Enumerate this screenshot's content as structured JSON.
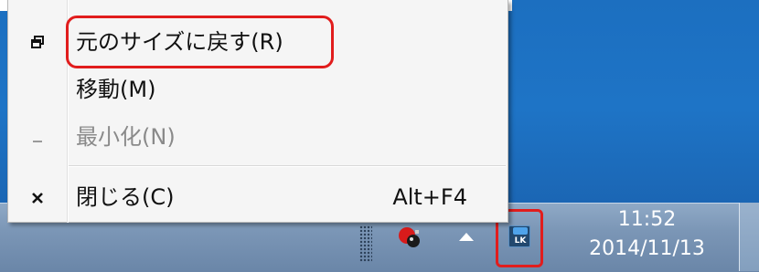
{
  "menu": {
    "items": [
      {
        "label": "元のサイズに戻す(R)",
        "icon": "restore-icon",
        "enabled": true
      },
      {
        "label": "移動(M)",
        "icon": "",
        "enabled": true
      },
      {
        "label": "最小化(N)",
        "icon": "minimize-icon",
        "enabled": false
      },
      {
        "label": "閉じる(C)",
        "icon": "close-icon",
        "shortcut": "Alt+F4",
        "enabled": true
      }
    ]
  },
  "taskbar": {
    "clock": {
      "time": "11:52",
      "date": "2014/11/13"
    },
    "tray_icons": [
      "app-tray-icon",
      "show-hidden-icons-arrow",
      "lk-tray-icon"
    ],
    "lk_icon_label": "LK"
  },
  "colors": {
    "highlight": "#e11d1d",
    "desktop": "#1c6fc0",
    "taskbar": "#7b96b6",
    "menu_bg": "#f5f5f5",
    "disabled_text": "#8a8a8a"
  }
}
